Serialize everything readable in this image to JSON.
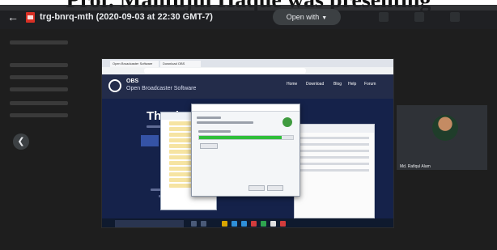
{
  "background_heading": "Prof. Mahfujul Haque was presenting",
  "viewer": {
    "file_title": "trg-bnrq-mth (2020-09-03 at 22:30 GMT-7)",
    "open_with_label": "Open with"
  },
  "meeting_video": {
    "browser_tabs": [
      "Open Broadcaster Software",
      "Download OBS"
    ],
    "site": {
      "name": "OBS",
      "subtitle": "Open Broadcaster Software",
      "nav": [
        "Home",
        "Download",
        "Blog",
        "Help",
        "Forum"
      ],
      "hero_heading": "Thank"
    },
    "install_dialog": {
      "progress_percent": 88
    }
  },
  "participant": {
    "name": "Md. Rafiqul Alam"
  },
  "icons": {
    "back": "arrow-left-icon",
    "file": "video-file-icon",
    "open_with": "chevron-down-icon",
    "prev": "chevron-left-icon"
  },
  "colors": {
    "toolbar": "#202124",
    "progress": "#2fbf3a",
    "obs_header": "#232c4a"
  }
}
